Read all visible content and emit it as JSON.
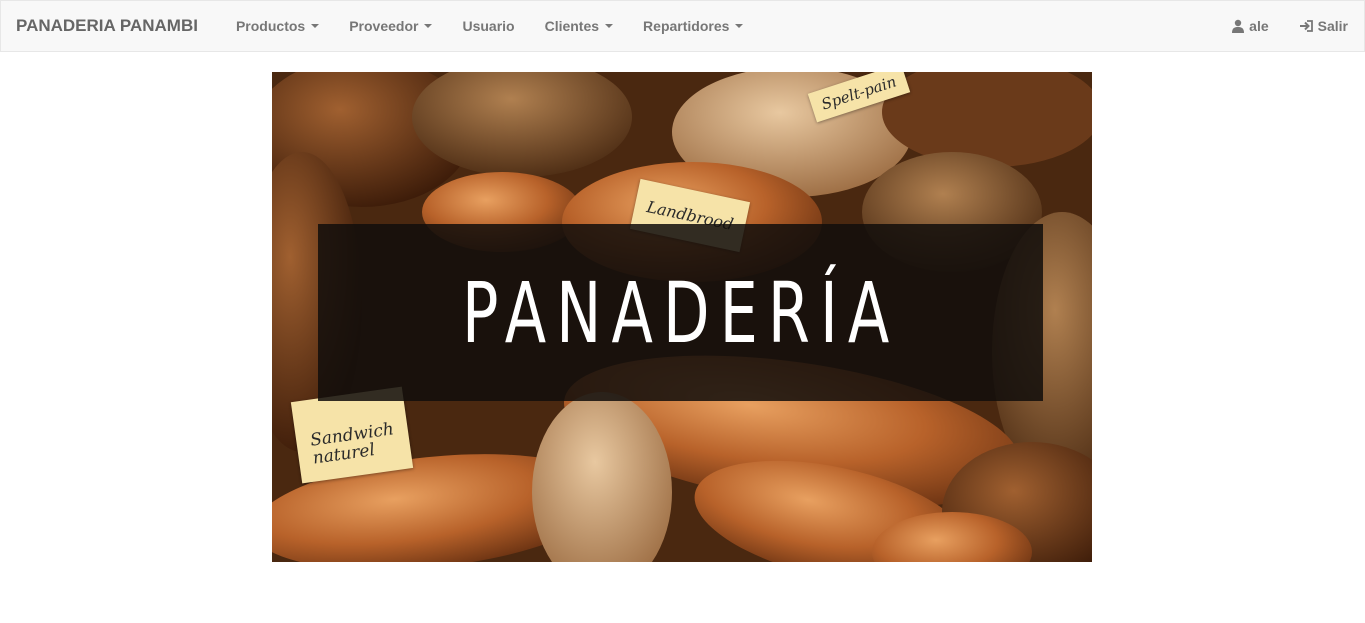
{
  "navbar": {
    "brand": "PANADERIA PANAMBI",
    "menu": [
      {
        "label": "Productos",
        "dropdown": true
      },
      {
        "label": "Proveedor",
        "dropdown": true
      },
      {
        "label": "Usuario",
        "dropdown": false
      },
      {
        "label": "Clientes",
        "dropdown": true
      },
      {
        "label": "Repartidores",
        "dropdown": true
      }
    ],
    "user": {
      "label": "ale",
      "icon": "user-icon"
    },
    "logout": {
      "label": "Salir",
      "icon": "sign-in-icon"
    }
  },
  "hero": {
    "title": "PANADERÍA",
    "labels": {
      "sandwich": "Sandwich\nnaturel",
      "landbrood": "Landbrood",
      "spelt": "Spelt-pain"
    }
  },
  "colors": {
    "navbar_bg": "#f8f8f8",
    "nav_text": "#777777",
    "banner_bg": "#120e0c",
    "banner_text": "#ffffff"
  }
}
